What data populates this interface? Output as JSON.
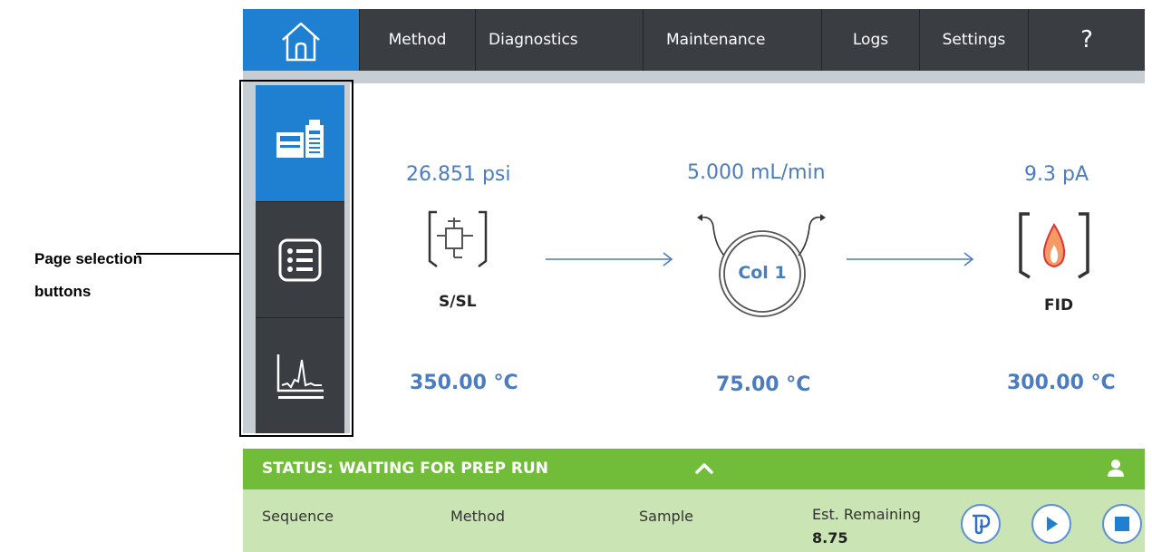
{
  "callout": {
    "line1": "Page selection",
    "line2": "buttons"
  },
  "nav": {
    "home_icon": "home-icon",
    "tabs": [
      "Method",
      "Diagnostics",
      "Maintenance",
      "Logs",
      "Settings"
    ],
    "help": "?"
  },
  "rail": {
    "buttons": [
      {
        "icon": "instrument-overview-icon",
        "active": true
      },
      {
        "icon": "list-icon",
        "active": false
      },
      {
        "icon": "chromatogram-icon",
        "active": false
      }
    ]
  },
  "flow": {
    "inlet": {
      "reading": "26.851 psi",
      "label": "S/SL",
      "temp": "350.00 °C"
    },
    "column": {
      "reading": "5.000 mL/min",
      "label": "Col 1",
      "temp": "75.00 °C"
    },
    "detector": {
      "reading": "9.3 pA",
      "label": "FID",
      "temp": "300.00 °C"
    }
  },
  "status": {
    "text": "STATUS: WAITING FOR PREP RUN",
    "fields": [
      "Sequence",
      "Method",
      "Sample"
    ],
    "est_label": "Est. Remaining",
    "est_value": "8.75"
  },
  "colors": {
    "accent": "#1f7fd1",
    "nav": "#3a3d42",
    "status_green": "#71bd3a",
    "value_blue": "#4c7cc0"
  }
}
